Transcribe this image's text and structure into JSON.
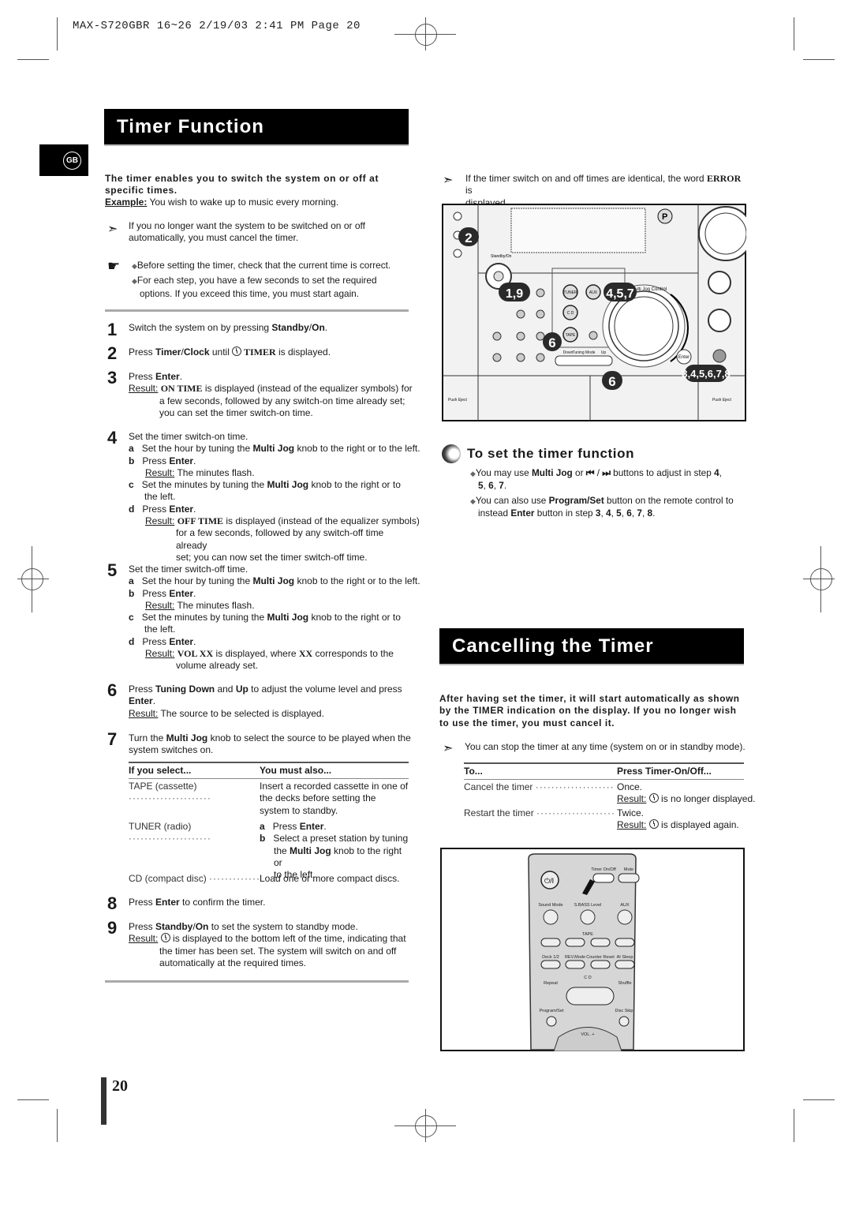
{
  "print_header": "MAX-S720GBR 16~26  2/19/03 2:41 PM  Page 20",
  "language_badge": "GB",
  "timer_function": {
    "title": "Timer Function",
    "intro": [
      {
        "t": "The timer enables you to switch the system on or off at specific times.",
        "b": true
      }
    ],
    "example": [
      {
        "t": "Example:",
        "b": true,
        "u": true
      },
      {
        "t": " You wish to wake up to music every morning."
      }
    ],
    "note": "If you no longer want the system to be switched on or off automatically, you must cancel the timer.",
    "tips": [
      "Before setting the timer, check that the current time is correct.",
      "For each step, you have a few seconds to set the required options. If you exceed this time, you must start again."
    ],
    "steps": {
      "s1": [
        {
          "t": "Switch the system on by pressing "
        },
        {
          "t": "Standby",
          "b": true
        },
        {
          "t": "/"
        },
        {
          "t": "On",
          "b": true
        },
        {
          "t": "."
        }
      ],
      "s2a": [
        {
          "t": "Press "
        },
        {
          "t": "Timer",
          "b": true
        },
        {
          "t": "/"
        },
        {
          "t": "Clock",
          "b": true
        },
        {
          "t": " until "
        }
      ],
      "s2b": [
        {
          "t": " TIMER",
          "s": true
        },
        {
          "t": " is displayed."
        }
      ],
      "s3": [
        {
          "t": "Press "
        },
        {
          "t": "Enter",
          "b": true
        },
        {
          "t": "."
        }
      ],
      "s3r": [
        {
          "t": "Result:",
          "u": true
        },
        {
          "t": " "
        },
        {
          "t": "ON TIME",
          "s": true
        },
        {
          "t": " is displayed (instead of the equalizer symbols) for"
        }
      ],
      "s3r2": "a few seconds, followed by any switch-on time already set;",
      "s3r3": "you can set the timer switch-on time.",
      "s4": "Set the timer switch-on time.",
      "s4a": [
        {
          "t": "a",
          "b": true
        },
        {
          "t": "   Set the hour by tuning the "
        },
        {
          "t": "Multi Jog",
          "b": true
        },
        {
          "t": " knob to the right or to the left."
        }
      ],
      "s4b": [
        {
          "t": "b",
          "b": true
        },
        {
          "t": "   Press "
        },
        {
          "t": "Enter",
          "b": true
        },
        {
          "t": "."
        }
      ],
      "s4br": [
        {
          "t": "Result:",
          "u": true
        },
        {
          "t": " The minutes flash."
        }
      ],
      "s4c": [
        {
          "t": "c",
          "b": true
        },
        {
          "t": "   Set the minutes by tuning the "
        },
        {
          "t": "Multi Jog",
          "b": true
        },
        {
          "t": " knob to the right or to"
        }
      ],
      "s4c2": "the left.",
      "s4d": [
        {
          "t": "d",
          "b": true
        },
        {
          "t": "   Press "
        },
        {
          "t": "Enter",
          "b": true
        },
        {
          "t": "."
        }
      ],
      "s4dr": [
        {
          "t": "Result:",
          "u": true
        },
        {
          "t": " "
        },
        {
          "t": "OFF TIME",
          "s": true
        },
        {
          "t": " is displayed (instead of the equalizer symbols)"
        }
      ],
      "s4dr2": "for a few seconds, followed by any switch-off time already",
      "s4dr3": "set; you can now set the timer switch-off time.",
      "s5": "Set the timer switch-off time.",
      "s5a": [
        {
          "t": "a",
          "b": true
        },
        {
          "t": "   Set the hour by tuning the "
        },
        {
          "t": "Multi Jog",
          "b": true
        },
        {
          "t": " knob to the right or to the left."
        }
      ],
      "s5b": [
        {
          "t": "b",
          "b": true
        },
        {
          "t": "   Press "
        },
        {
          "t": "Enter",
          "b": true
        },
        {
          "t": "."
        }
      ],
      "s5br": [
        {
          "t": "Result:",
          "u": true
        },
        {
          "t": " The minutes flash."
        }
      ],
      "s5c": [
        {
          "t": "c",
          "b": true
        },
        {
          "t": "   Set the minutes by tuning the "
        },
        {
          "t": "Multi Jog",
          "b": true
        },
        {
          "t": " knob to the right or to"
        }
      ],
      "s5c2": "the left.",
      "s5d": [
        {
          "t": "d",
          "b": true
        },
        {
          "t": "   Press "
        },
        {
          "t": "Enter",
          "b": true
        },
        {
          "t": "."
        }
      ],
      "s5dr": [
        {
          "t": "Result:",
          "u": true
        },
        {
          "t": " "
        },
        {
          "t": "VOL XX",
          "s": true
        },
        {
          "t": " is displayed, where "
        },
        {
          "t": "XX",
          "s": true
        },
        {
          "t": " corresponds to the"
        }
      ],
      "s5dr2": "volume already set.",
      "s6": [
        {
          "t": "Press "
        },
        {
          "t": "Tuning Down",
          "b": true
        },
        {
          "t": " and "
        },
        {
          "t": "Up",
          "b": true
        },
        {
          "t": " to adjust the volume level and press"
        }
      ],
      "s6b": [
        {
          "t": "Enter",
          "b": true
        },
        {
          "t": "."
        }
      ],
      "s6r": [
        {
          "t": "Result:",
          "u": true
        },
        {
          "t": " The source to be selected is displayed."
        }
      ],
      "s7": [
        {
          "t": "Turn the "
        },
        {
          "t": "Multi Jog",
          "b": true
        },
        {
          "t": " knob to select the source to be played when the"
        }
      ],
      "s7b": "system switches on.",
      "s8": [
        {
          "t": "Press "
        },
        {
          "t": "Enter",
          "b": true
        },
        {
          "t": " to confirm the timer."
        }
      ],
      "s9": [
        {
          "t": "Press "
        },
        {
          "t": "Standby",
          "b": true
        },
        {
          "t": "/"
        },
        {
          "t": "On",
          "b": true
        },
        {
          "t": " to set the system to standby mode."
        }
      ],
      "s9r": [
        {
          "t": "Result:",
          "u": true
        },
        {
          "t": " "
        }
      ],
      "s9r1b": " is displayed to the bottom left of the time, indicating that",
      "s9r2": "the timer has been set. The system will switch on and off",
      "s9r3": "automatically at the required times."
    },
    "step_numbers": [
      "1",
      "2",
      "3",
      "4",
      "5",
      "6",
      "7",
      "8",
      "9"
    ],
    "source_table": {
      "headers": [
        "If you select...",
        "You must also..."
      ],
      "rows": [
        {
          "source": "TAPE (cassette)",
          "action": [
            "Insert a recorded cassette in one of",
            "the decks before setting the",
            "system to standby."
          ]
        },
        {
          "source": "TUNER (radio)",
          "action_a": [
            {
              "t": "a",
              "b": true
            },
            {
              "t": "   Press "
            },
            {
              "t": "Enter",
              "b": true
            },
            {
              "t": "."
            }
          ],
          "action_b": [
            {
              "t": "b",
              "b": true
            },
            {
              "t": "   Select a preset station by tuning"
            }
          ],
          "action_b2": [
            {
              "t": "the "
            },
            {
              "t": "Multi Jog",
              "b": true
            },
            {
              "t": " knob to the right or"
            }
          ],
          "action_b3": "to the left."
        },
        {
          "source": "CD (compact disc)",
          "action": [
            "Load one or more compact discs."
          ]
        }
      ]
    }
  },
  "error_note": [
    {
      "t": "If the timer switch on and off times are identical, the word "
    },
    {
      "t": "ERROR",
      "s": true
    },
    {
      "t": " is"
    }
  ],
  "error_note2": "displayed.",
  "device_illustration": {
    "callouts": [
      "2",
      "1,9",
      "4,5,7",
      "6",
      "6",
      "3,4,5,6,7,8"
    ],
    "labels": {
      "standby": "Standby/On",
      "tuner": "TUNER",
      "aux": "AUX",
      "cd": "C D",
      "tape": "TAPE",
      "enter": "Enter",
      "jog": "Multi Jog  Control",
      "down": "Down",
      "mode": "Tuning Mode",
      "up": "Up",
      "eject": "Push Eject",
      "eject2": "Push Eject",
      "p": "P"
    }
  },
  "set_timer": {
    "heading": "To set the timer function",
    "b1": [
      {
        "t": "You may use "
      },
      {
        "t": "Multi Jog",
        "b": true
      },
      {
        "t": " or "
      },
      {
        "t": "⏮",
        "b": true
      },
      {
        "t": "  /  "
      },
      {
        "t": "⏭",
        "b": true
      },
      {
        "t": " buttons to adjust in step "
      },
      {
        "t": "4",
        "b": true
      },
      {
        "t": ","
      }
    ],
    "b1b": [
      {
        "t": "5",
        "b": true
      },
      {
        "t": ", "
      },
      {
        "t": "6",
        "b": true
      },
      {
        "t": ", "
      },
      {
        "t": "7",
        "b": true
      },
      {
        "t": "."
      }
    ],
    "b2": [
      {
        "t": "You can also use "
      },
      {
        "t": "Program/Set",
        "b": true
      },
      {
        "t": " button on the remote control to"
      }
    ],
    "b2b": [
      {
        "t": "instead "
      },
      {
        "t": "Enter",
        "b": true
      },
      {
        "t": " button in step "
      },
      {
        "t": "3",
        "b": true
      },
      {
        "t": ", "
      },
      {
        "t": "4",
        "b": true
      },
      {
        "t": ", "
      },
      {
        "t": "5",
        "b": true
      },
      {
        "t": ", "
      },
      {
        "t": "6",
        "b": true
      },
      {
        "t": ", "
      },
      {
        "t": "7",
        "b": true
      },
      {
        "t": ", "
      },
      {
        "t": "8",
        "b": true
      },
      {
        "t": "."
      }
    ]
  },
  "cancel": {
    "title": "Cancelling the Timer",
    "intro": [
      "After having set the timer, it will start automatically as shown",
      "by the TIMER indication on the display. If you no longer wish",
      "to use the timer, you must cancel it."
    ],
    "note": "You can stop the timer at any time (system on or in standby mode).",
    "table": {
      "headers": [
        "To...",
        "Press Timer-On/Off..."
      ],
      "rows": [
        {
          "to": "Cancel the timer",
          "press": "Once.",
          "result_label": "Result:",
          "result": " is no longer displayed."
        },
        {
          "to": "Restart the timer",
          "press": "Twice.",
          "result_label": "Result:",
          "result": " is displayed again."
        }
      ]
    }
  },
  "remote_illustration": {
    "labels": [
      "Timer On/Off",
      "Mute",
      "Sound Mode",
      "S.BASS Level",
      "AUX",
      "TAPE",
      "Deck 1/2",
      "REV.Mode",
      "Counter Reset",
      "AI Sleep",
      "C D",
      "Repeat",
      "Shuffle",
      "Program/Set",
      "Disc Skip",
      "VOL. +"
    ]
  },
  "page_number": "20"
}
